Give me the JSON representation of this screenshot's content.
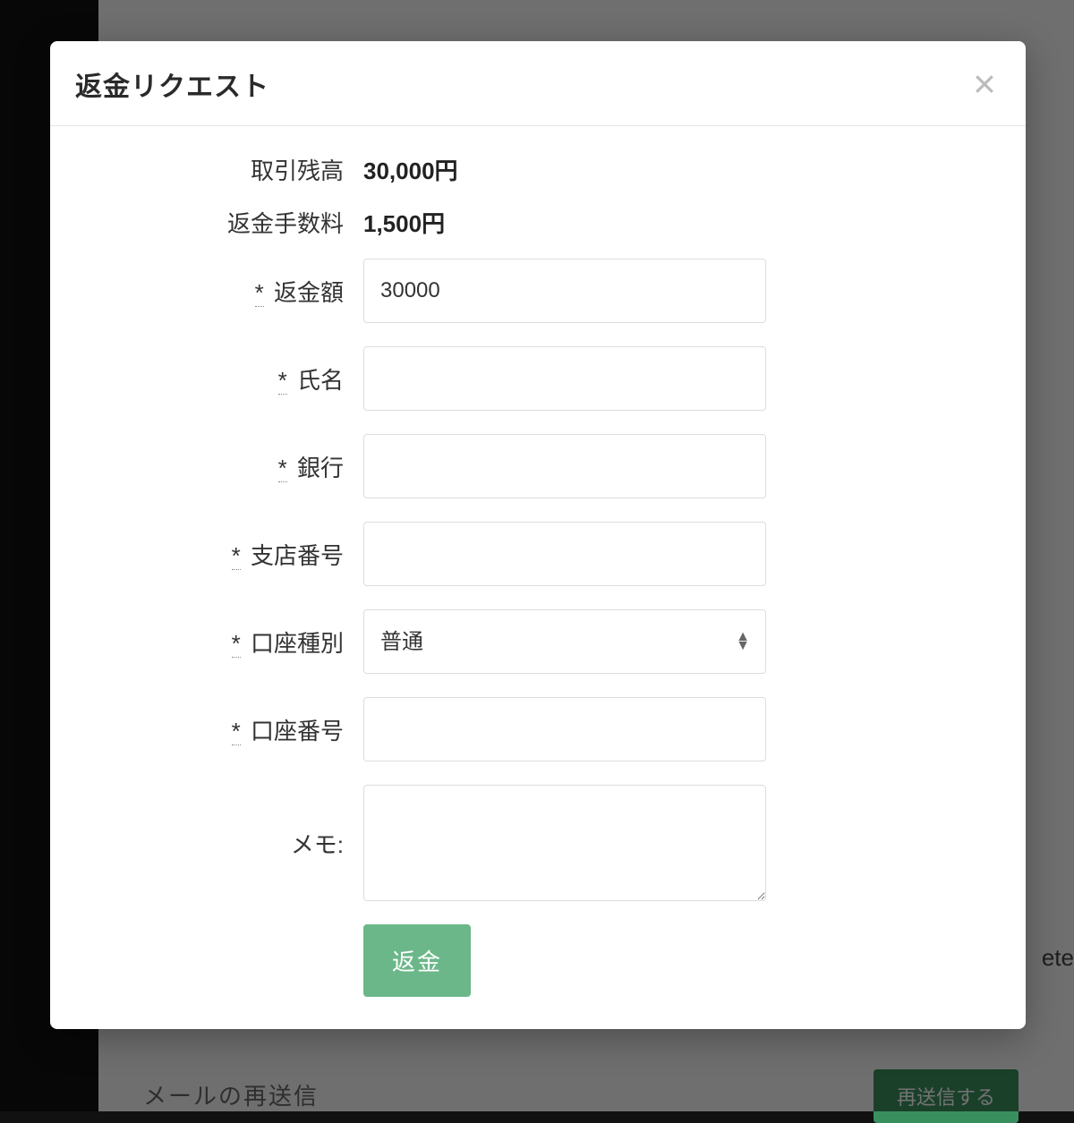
{
  "modal": {
    "title": "返金リクエスト",
    "balance_label": "取引残高",
    "balance_value": "30,000円",
    "fee_label": "返金手数料",
    "fee_value": "1,500円",
    "amount_label": "返金額",
    "amount_value": "30000",
    "name_label": "氏名",
    "name_value": "",
    "bank_label": "銀行",
    "bank_value": "",
    "branch_label": "支店番号",
    "branch_value": "",
    "account_type_label": "口座種別",
    "account_type_value": "普通",
    "account_number_label": "口座番号",
    "account_number_value": "",
    "memo_label": "メモ:",
    "memo_value": "",
    "required_mark": "*",
    "submit_label": "返金"
  },
  "background": {
    "resend_label": "メールの再送信",
    "resend_button": "再送信する",
    "right_text": "ete"
  }
}
